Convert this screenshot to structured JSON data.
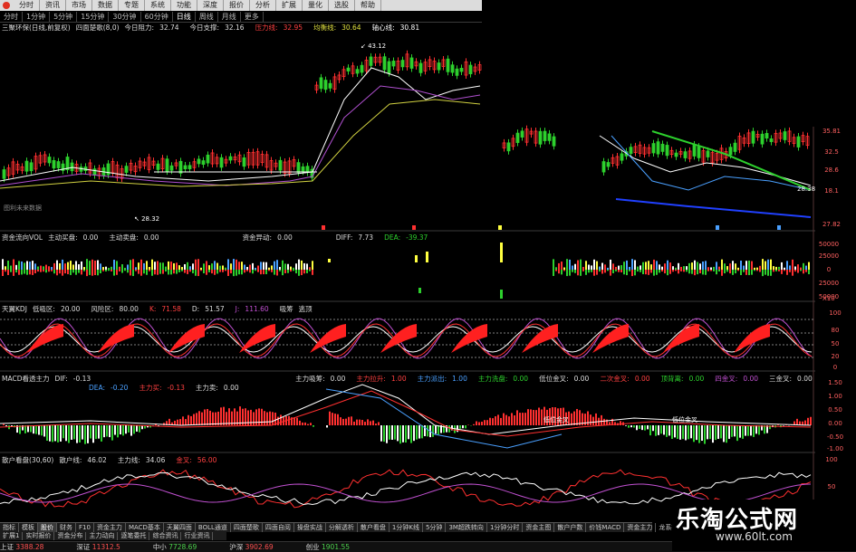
{
  "menu_bar": {
    "items": [
      "分时",
      "资讯",
      "市场",
      "数据",
      "专题",
      "系统",
      "功能",
      "深度",
      "报价",
      "分析",
      "扩展",
      "量化",
      "选股",
      "帮助"
    ]
  },
  "period_tabs": {
    "items": [
      "分时",
      "1分钟",
      "5分钟",
      "15分钟",
      "30分钟",
      "60分钟",
      "日线",
      "周线",
      "月线",
      "更多"
    ],
    "active": "日线"
  },
  "price_panel": {
    "title": "三聚环保(日线,前复权)",
    "indicator": "四面楚歌(8,0)",
    "today_resistance_label": "今日阻力:",
    "today_resistance": "32.74",
    "today_support_label": "今日支撑:",
    "today_support": "32.16",
    "pressure_label": "压力线:",
    "pressure": "32.95",
    "balance_label": "均衡线:",
    "balance": "30.64",
    "pivot_label": "轴心线:",
    "pivot": "30.81",
    "high_marker": "43.12",
    "low_marker": "28.32",
    "watermark_note": "图利未来数据",
    "right_axis": [
      "35.81",
      "32.5",
      "28.6",
      "18.1",
      "27.82"
    ],
    "price_tag": "28.38"
  },
  "volume_panel": {
    "title": "资金流向VOL",
    "main_buy_label": "主动买盘:",
    "main_buy": "0.00",
    "main_sell_label": "主动卖盘:",
    "main_sell": "0.00",
    "fund_label": "资金异动:",
    "fund": "0.00",
    "diff_label": "DIFF:",
    "diff": "7.73",
    "dea_label": "DEA:",
    "dea": "-39.37",
    "right_axis": [
      "50000",
      "25000",
      "0",
      "25000",
      "50000"
    ],
    "unit": "X10"
  },
  "kdj_panel": {
    "title": "天翼KDJ",
    "low_zone_label": "低吸区:",
    "low_zone": "20.00",
    "risk_zone_label": "风险区:",
    "risk_zone": "80.00",
    "k_label": "K:",
    "k": "71.58",
    "d_label": "D:",
    "d": "51.57",
    "j_label": "J:",
    "j": "111.60",
    "absorb_label": "吸筹",
    "escape_label": "逃顶",
    "right_axis": [
      "100",
      "80",
      "50",
      "20",
      "0"
    ]
  },
  "macd_panel": {
    "title": "MACD看透主力",
    "dif_label": "DIF:",
    "dif": "-0.13",
    "dea_label": "DEA:",
    "dea": "-0.20",
    "main_buy_label": "主力买:",
    "main_buy": "-0.13",
    "main_sell_label": "主力卖:",
    "main_sell": "0.00",
    "main_absorb_label": "主力吸筹:",
    "main_absorb": "0.00",
    "main_lift_label": "主力拉升:",
    "main_lift": "1.00",
    "main_out_label": "主力派出:",
    "main_out": "1.00",
    "main_wash_label": "主力洗盘:",
    "main_wash": "0.00",
    "low_gold_label": "低位金叉:",
    "low_gold": "0.00",
    "two_gold_label": "二次金叉:",
    "two_gold": "0.00",
    "top_div_label": "顶背离:",
    "top_div": "0.00",
    "four_gold_label": "四金叉:",
    "four_gold": "0.00",
    "three_gold_label": "三金叉:",
    "three_gold": "0.00",
    "annotation": "低位金叉",
    "right_axis": [
      "1.50",
      "1.00",
      "0.50",
      "0.00",
      "-0.50",
      "-1.00"
    ]
  },
  "retail_panel": {
    "title": "散户看盘(30,60)",
    "retail_label": "散户线:",
    "retail": "46.02",
    "main_label": "主力线:",
    "main": "34.06",
    "gold_label": "金叉:",
    "gold": "56.00",
    "right_axis": [
      "100",
      "50",
      "0"
    ]
  },
  "bottom_tabs": {
    "items": [
      "指标",
      "模板",
      "股价",
      "财务",
      "F10",
      "资金主力",
      "MACD基本",
      "天翼四面",
      "BOLL通道",
      "四面楚歌",
      "四面自阅",
      "操盘实战",
      "分解透析",
      "散户看盘",
      "1分钟K线",
      "5分钟",
      "3M超跌转向",
      "1分钟分时",
      "资金主图",
      "散户户数",
      "价钱MACD",
      "资金主力",
      "龙系指标"
    ],
    "active": "股价"
  },
  "bottom_tabs_row2": {
    "items": [
      "扩展1",
      "实时报价",
      "资金分布",
      "主力动向",
      "逐笔委托",
      "综合资讯",
      "行业资讯"
    ]
  },
  "status_bar": {
    "items": [
      {
        "name": "上证",
        "value": "3388.28"
      },
      {
        "name": "深证",
        "value": "11312.5"
      },
      {
        "name": "中小",
        "value": "7728.69"
      },
      {
        "name": "沪深",
        "value": "3902.69"
      },
      {
        "name": "创业",
        "value": "1901.55"
      }
    ]
  },
  "watermark": {
    "title": "乐淘公式网",
    "url": "www.60lt.com"
  },
  "colors": {
    "up": "#ff3030",
    "down": "#2dd02d",
    "ma1": "#ffffff",
    "ma2": "#d0d040",
    "ma3": "#b050d0",
    "ma4": "#4aa0ff",
    "accent_blue": "#2040ff"
  }
}
